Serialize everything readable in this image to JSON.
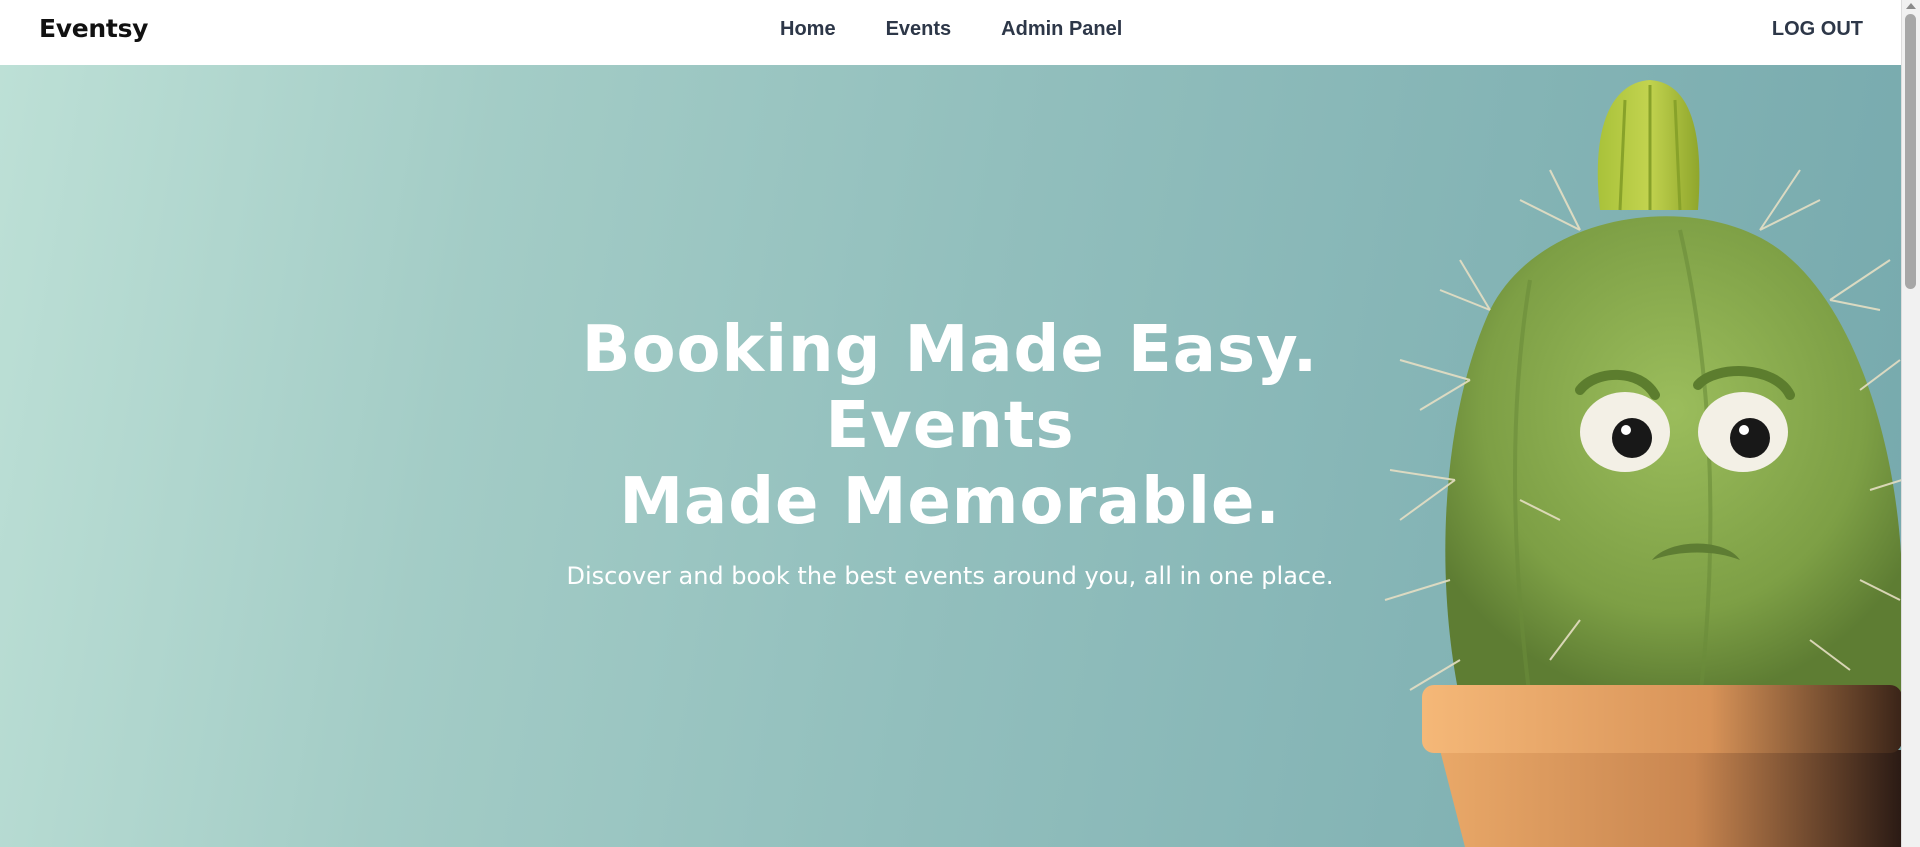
{
  "navbar": {
    "brand": "Eventsy",
    "links": [
      "Home",
      "Events",
      "Admin Panel"
    ],
    "logout": "LOG OUT"
  },
  "hero": {
    "title_line1": "Booking Made Easy. Events",
    "title_line2": "Made Memorable.",
    "subtitle": "Discover and book the best events around you, all in one place.",
    "image": "cactus-mascot-illustration"
  },
  "colors": {
    "nav_text": "#2d3748",
    "hero_gradient_start": "#bde0d6",
    "hero_gradient_end": "#76a9ad",
    "cactus_green": "#7da24a",
    "pot_orange": "#d9955a"
  }
}
